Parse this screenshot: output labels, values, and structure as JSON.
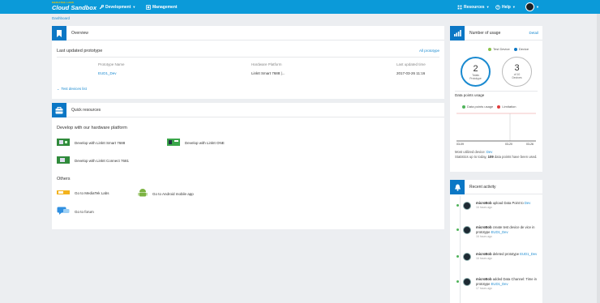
{
  "brand": {
    "small": "MEDIATEK LABS",
    "title": "Cloud Sandbox"
  },
  "nav": {
    "development": "Development",
    "management": "Management",
    "resources": "Resources",
    "help": "Help"
  },
  "breadcrumb": "Dashboard",
  "overview": {
    "title": "Overview",
    "last_updated": "Last updated prototype",
    "all_link": "All prototype",
    "cols": [
      "Prototype Name",
      "Hardware Platform",
      "Last updated time"
    ],
    "row": [
      "EUD1_Dev",
      "LinkIt Smart 7688 |...",
      "2017-03-26 11:16"
    ],
    "test_devices": "Test devices list"
  },
  "quick": {
    "title": "Quick resources",
    "hw_heading": "Develop with our hardware platform",
    "hw": [
      "Develop with LinkIt Smart 7688",
      "Develop with LinkIt ONE",
      "Develop with LinkIt Connect 7681"
    ],
    "others_heading": "Others",
    "others": [
      "Go to MediaTek Labs",
      "Go to Android mobile app",
      "Go to forum"
    ]
  },
  "usage": {
    "title": "Number of usage",
    "detail": "Detail",
    "legend": [
      "Test Device",
      "Device"
    ],
    "totals": {
      "num": "2",
      "cap1": "Totals",
      "cap2": "Prototype"
    },
    "devices": {
      "num": "3",
      "cap1": "of 10",
      "cap2": "Devices"
    },
    "dp_title": "Data points usage",
    "dp_legend": [
      "Data points usage",
      "Limitation"
    ],
    "axis": [
      "03-09",
      "03-20",
      "03-26"
    ],
    "most_label": "Most utilized device:",
    "most_device": "Dev",
    "stats_pre": "Statistics up to today,",
    "stats_num": "109",
    "stats_post": "data points have been used."
  },
  "chart_data": {
    "type": "line",
    "title": "Data points usage",
    "series": [
      {
        "name": "Data points usage"
      },
      {
        "name": "Limitation"
      }
    ],
    "x": [
      "03-09",
      "03-20",
      "03-26"
    ],
    "xlabel": "",
    "ylabel": ""
  },
  "activity": {
    "title": "Recent activity",
    "items": [
      {
        "user": "microBob",
        "action": "upload Data Point to",
        "target": "Dev",
        "time": "16 hours ago"
      },
      {
        "user": "microBob",
        "action": "create test device de vice in prototype",
        "target": "EUD1_Dev",
        "time": "16 hours ago"
      },
      {
        "user": "microBob",
        "action": "deleted prototype",
        "target": "EUD1_Dev",
        "time": "16 hours ago"
      },
      {
        "user": "microBob",
        "action": "added Data Channel: Time in prototype",
        "target": "EUD1_Dev",
        "time": "17 hours ago"
      }
    ]
  },
  "colors": {
    "header": "#0b9ad9",
    "icon_bg": "#0b77c5",
    "link": "#1a8ad0",
    "accent_green": "#4fb35a",
    "accent_red": "#e03c3c"
  }
}
